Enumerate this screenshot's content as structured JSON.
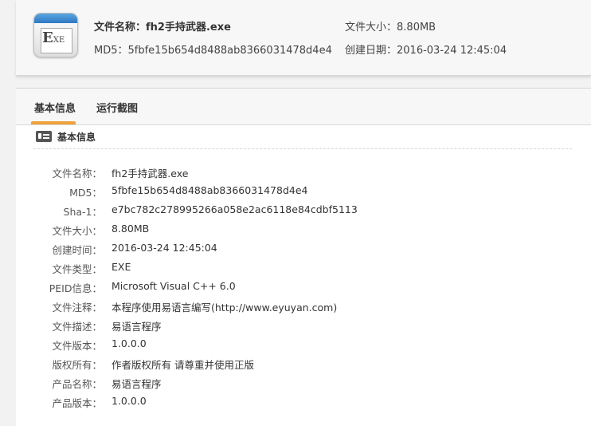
{
  "header": {
    "icon": "exe-file-icon",
    "name_label": "文件名称：",
    "name_value": "fh2手持武器.exe",
    "md5_label": "MD5：",
    "md5_value": "5fbfe15b654d8488ab8366031478d4e4",
    "size_label": "文件大小：",
    "size_value": "8.80MB",
    "date_label": "创建日期：",
    "date_value": "2016-03-24 12:45:04"
  },
  "tabs": [
    {
      "label": "基本信息",
      "active": true
    },
    {
      "label": "运行截图",
      "active": false
    }
  ],
  "section": {
    "icon": "id-card-icon",
    "title": "基本信息"
  },
  "rows": [
    {
      "label": "文件名称：",
      "value": "fh2手持武器.exe"
    },
    {
      "label": "MD5：",
      "value": "5fbfe15b654d8488ab8366031478d4e4"
    },
    {
      "label": "Sha-1：",
      "value": "e7bc782c278995266a058e2ac6118e84cdbf5113"
    },
    {
      "label": "文件大小：",
      "value": "8.80MB"
    },
    {
      "label": "创建时间：",
      "value": "2016-03-24 12:45:04"
    },
    {
      "label": "文件类型：",
      "value": "EXE"
    },
    {
      "label": "PEID信息：",
      "value": "Microsoft Visual C++ 6.0"
    },
    {
      "label": "文件注释：",
      "value": "本程序使用易语言编写(http://www.eyuyan.com)"
    },
    {
      "label": "文件描述：",
      "value": "易语言程序"
    },
    {
      "label": "文件版本：",
      "value": "1.0.0.0"
    },
    {
      "label": "版权所有：",
      "value": "作者版权所有 请尊重并使用正版"
    },
    {
      "label": "产品名称：",
      "value": "易语言程序"
    },
    {
      "label": "产品版本：",
      "value": "1.0.0.0"
    }
  ],
  "colors": {
    "tab_accent": "#f0a03c",
    "background": "#f2f2f2",
    "panel": "#ffffff"
  }
}
